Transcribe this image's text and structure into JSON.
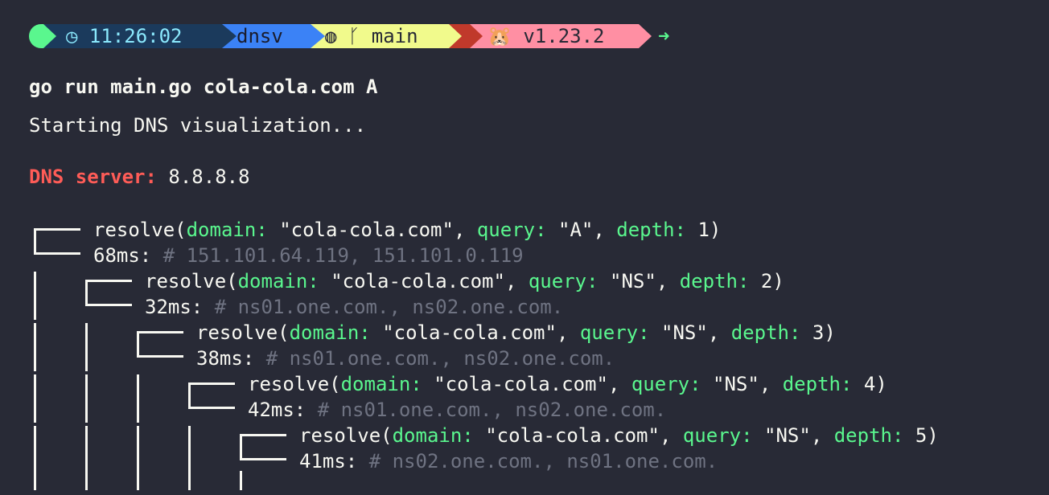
{
  "prompt": {
    "clock_icon": "clock-icon",
    "time": "11:26:02",
    "directory": "dnsv",
    "git_icon": "github-icon",
    "branch_icon": "git-branch-icon",
    "branch": "main",
    "go_icon": "gopher-hamster-emoji",
    "go_version": "v1.23.2",
    "return_icon": "arrow-right-icon",
    "colors": {
      "time_bg": "#1b3a5c",
      "dir_bg": "#3b82f6",
      "git_bg": "#f1fa8c",
      "go_bg": "#ff8fa3",
      "ok": "#5af78e"
    }
  },
  "command": "go run main.go cola-cola.com A",
  "status": "Starting DNS visualization...",
  "dns_server": {
    "label": "DNS server:",
    "value": "8.8.8.8"
  },
  "tree": [
    {
      "domain": "\"cola-cola.com\"",
      "query": "\"A\"",
      "depth": "1",
      "time": "68ms:",
      "result": "# 151.101.64.119, 151.101.0.119"
    },
    {
      "domain": "\"cola-cola.com\"",
      "query": "\"NS\"",
      "depth": "2",
      "time": "32ms:",
      "result": "# ns01.one.com., ns02.one.com."
    },
    {
      "domain": "\"cola-cola.com\"",
      "query": "\"NS\"",
      "depth": "3",
      "time": "38ms:",
      "result": "# ns01.one.com., ns02.one.com."
    },
    {
      "domain": "\"cola-cola.com\"",
      "query": "\"NS\"",
      "depth": "4",
      "time": "42ms:",
      "result": "# ns01.one.com., ns02.one.com."
    },
    {
      "domain": "\"cola-cola.com\"",
      "query": "\"NS\"",
      "depth": "5",
      "time": "41ms:",
      "result": "# ns02.one.com., ns01.one.com."
    }
  ],
  "tokens": {
    "resolve": "resolve(",
    "domain_key": "domain:",
    "query_key": "query:",
    "depth_key": "depth:",
    "comma": ",",
    "close": ")"
  }
}
